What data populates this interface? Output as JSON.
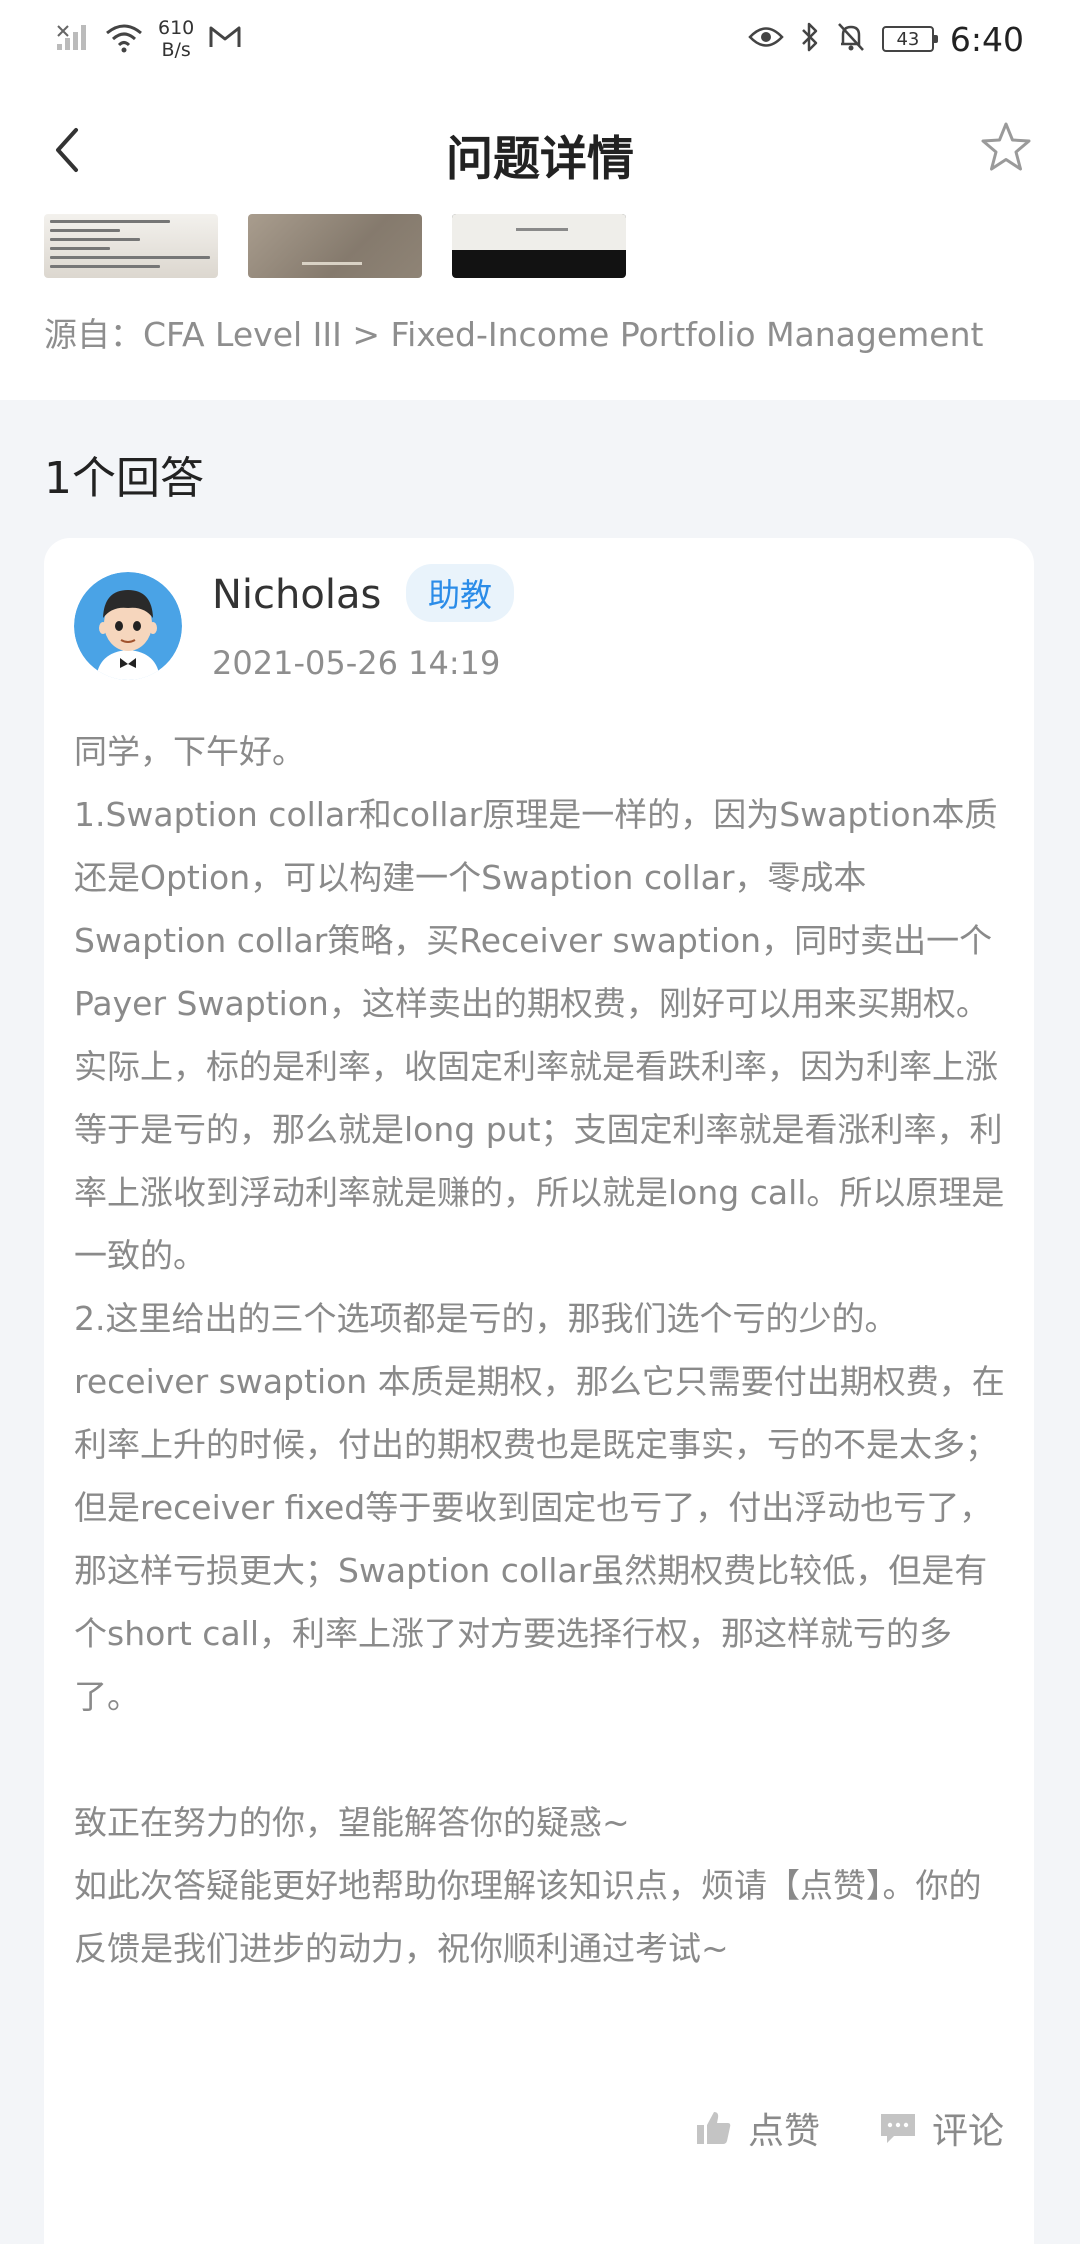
{
  "status_bar": {
    "network_speed_value": "610",
    "network_speed_unit": "B/s",
    "battery": "43",
    "time": "6:40"
  },
  "header": {
    "title": "问题详情"
  },
  "question": {
    "source": "源自：CFA Level III > Fixed-Income Portfolio Management"
  },
  "answers": {
    "count_label": "1个回答",
    "items": [
      {
        "author": "Nicholas",
        "role_badge": "助教",
        "timestamp": "2021-05-26 14:19",
        "paragraphs": [
          "同学，下午好。",
          "1.Swaption collar和collar原理是一样的，因为Swaption本质还是Option，可以构建一个Swaption collar，零成本Swaption collar策略，买Receiver swaption，同时卖出一个Payer Swaption，这样卖出的期权费，刚好可以用来买期权。",
          "实际上，标的是利率，收固定利率就是看跌利率，因为利率上涨等于是亏的，那么就是long put；支固定利率就是看涨利率，利率上涨收到浮动利率就是赚的，所以就是long call。所以原理是一致的。",
          "2.这里给出的三个选项都是亏的，那我们选个亏的少的。receiver swaption 本质是期权，那么它只需要付出期权费，在利率上升的时候，付出的期权费也是既定事实，亏的不是太多；但是receiver fixed等于要收到固定也亏了，付出浮动也亏了，那这样亏损更大；Swaption collar虽然期权费比较低，但是有个short call，利率上涨了对方要选择行权，那这样就亏的多了。",
          "致正在努力的你，望能解答你的疑惑~",
          "如此次答疑能更好地帮助你理解该知识点，烦请【点赞】。你的反馈是我们进步的动力，祝你顺利通过考试~"
        ],
        "like_label": "点赞",
        "comment_label": "评论"
      }
    ]
  }
}
